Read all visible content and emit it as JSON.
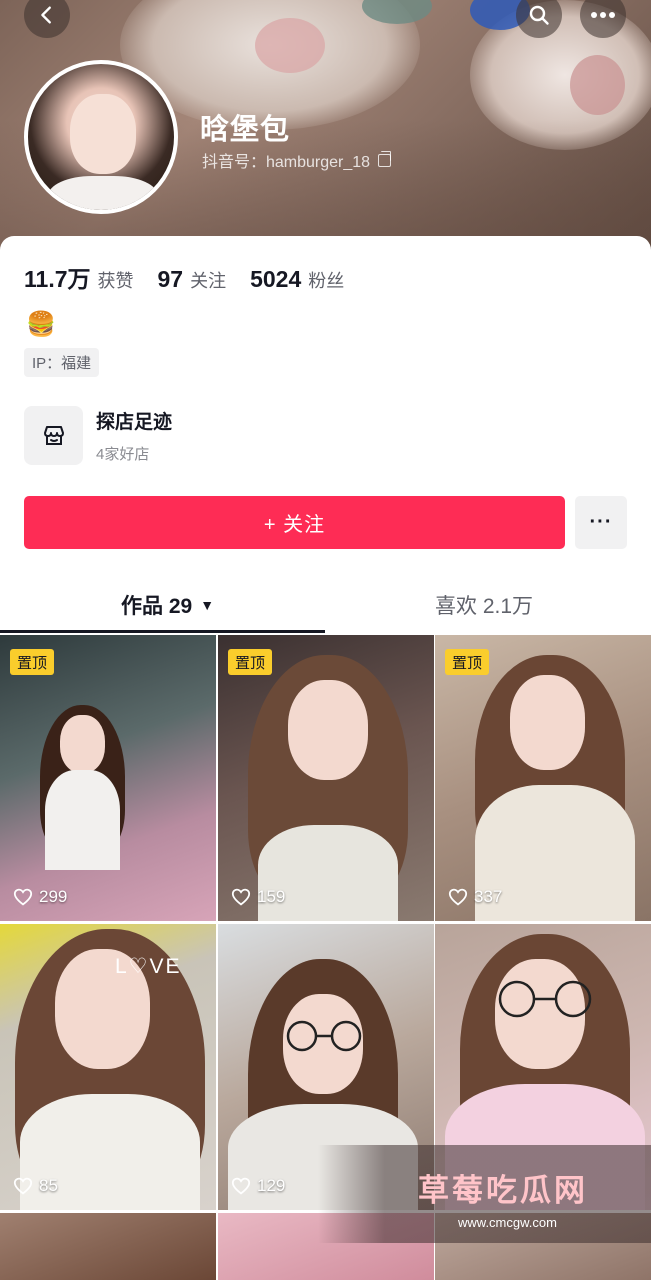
{
  "profile": {
    "nickname": "晗堡包",
    "douyin_id": "抖音号：hamburger_18",
    "bio_emoji": "🍔",
    "ip_location": "IP：福建"
  },
  "stats": [
    {
      "value": "11.7万",
      "label": "获赞"
    },
    {
      "value": "97",
      "label": "关注"
    },
    {
      "value": "5024",
      "label": "粉丝"
    }
  ],
  "shop": {
    "title": "探店足迹",
    "subtitle": "4家好店"
  },
  "actions": {
    "follow_label": "+ 关注",
    "more_label": "···"
  },
  "tabs": {
    "works": "作品 29",
    "likes": "喜欢 2.1万"
  },
  "videos": [
    {
      "pinned": "置顶",
      "likes": "299"
    },
    {
      "pinned": "置顶",
      "likes": "159"
    },
    {
      "pinned": "置顶",
      "likes": "337"
    },
    {
      "pinned": "",
      "likes": "85"
    },
    {
      "pinned": "",
      "likes": "129"
    },
    {
      "pinned": "",
      "likes": ""
    }
  ],
  "overlay_text": {
    "love": "L♡VE"
  },
  "watermark": {
    "name": "草莓吃瓜网",
    "url": "www.cmcgw.com"
  },
  "colors": {
    "accent": "#fe2c55",
    "pin_badge": "#facd2c"
  }
}
